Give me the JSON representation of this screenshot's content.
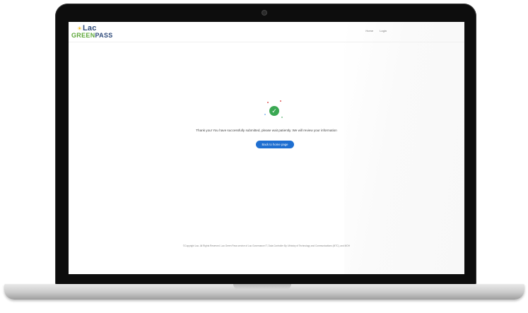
{
  "brand": {
    "logo_top": "Lac",
    "logo_green": "GREEN",
    "logo_pass": "PASS"
  },
  "nav": {
    "links": [
      "Home",
      "Login"
    ]
  },
  "content": {
    "message": "Thank you! You have successfully submitted, please wait patiently. We will review your information",
    "button_label": "Back to home page",
    "success_icon": "check-circle-icon"
  },
  "footer": {
    "text": "©Copyright Lao. All Rights Reserved. Lao Green Pass service of Lao Governance IT, Data Controller By: Ministry of Technology and Communications (MTC), and MOH"
  },
  "colors": {
    "accent": "#1f6fd1",
    "success": "#3aa853",
    "logo_blue": "#2e4a7a",
    "logo_green": "#5fa83a"
  }
}
